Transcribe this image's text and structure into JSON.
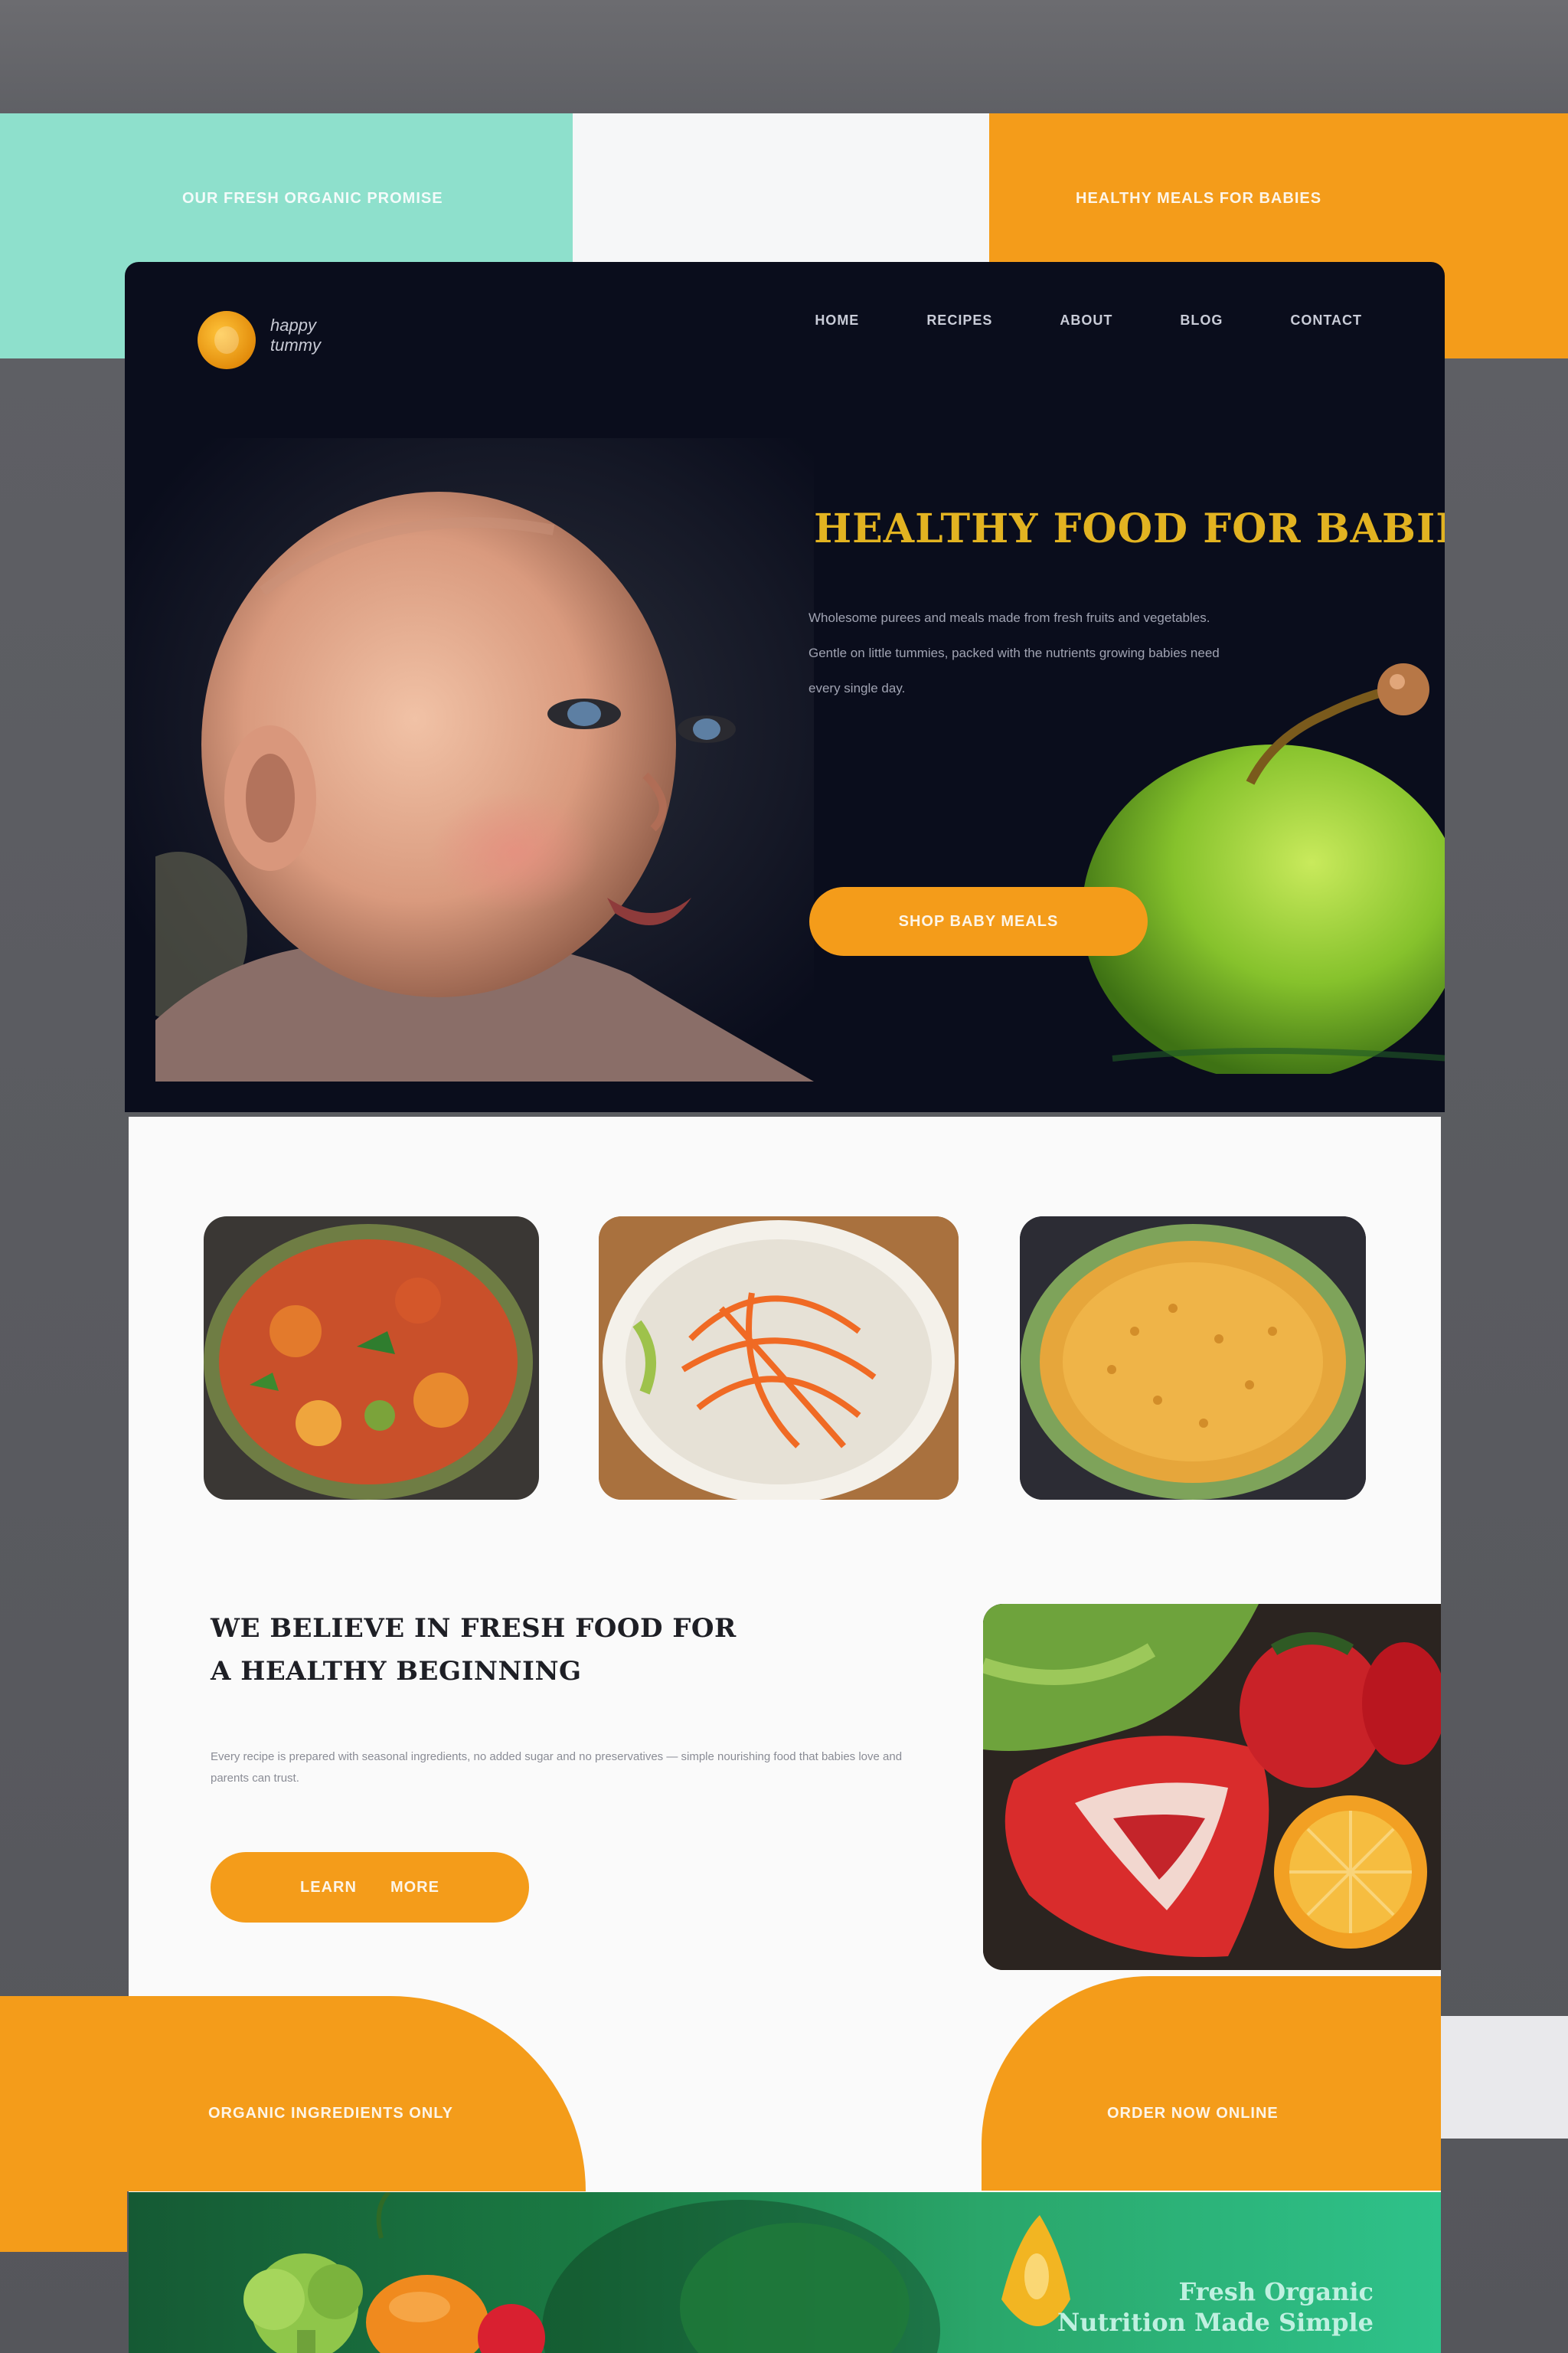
{
  "top_band": {
    "left_label": "OUR FRESH ORGANIC PROMISE",
    "right_label": "HEALTHY MEALS FOR BABIES"
  },
  "header": {
    "logo_line1": "happy",
    "logo_line2": "tummy",
    "nav": [
      "Home",
      "Recipes",
      "About",
      "Blog",
      "Contact"
    ]
  },
  "hero": {
    "title": "HEALTHY FOOD FOR BABIES",
    "body": "Wholesome purees and meals made from fresh fruits and vegetables. Gentle on little tummies, packed with the nutrients growing babies need every single day.",
    "cta": "SHOP BABY MEALS"
  },
  "featured": {
    "heading": "WE BELIEVE IN FRESH FOOD FOR A HEALTHY BEGINNING",
    "body": "Every recipe is prepared with seasonal ingredients, no added sugar and no preservatives — simple nourishing food that babies love and parents can trust.",
    "cta_left": "Learn",
    "cta_right": "More"
  },
  "bottom": {
    "left_label": "ORGANIC INGREDIENTS ONLY",
    "right_label": "ORDER NOW ONLINE",
    "banner_line1": "Fresh Organic",
    "banner_line2": "Nutrition Made Simple"
  },
  "colors": {
    "accent": "#f49c1a",
    "mint": "#8ee0cc",
    "dark": "#0a0d1c",
    "title_gold": "#e2b321"
  }
}
